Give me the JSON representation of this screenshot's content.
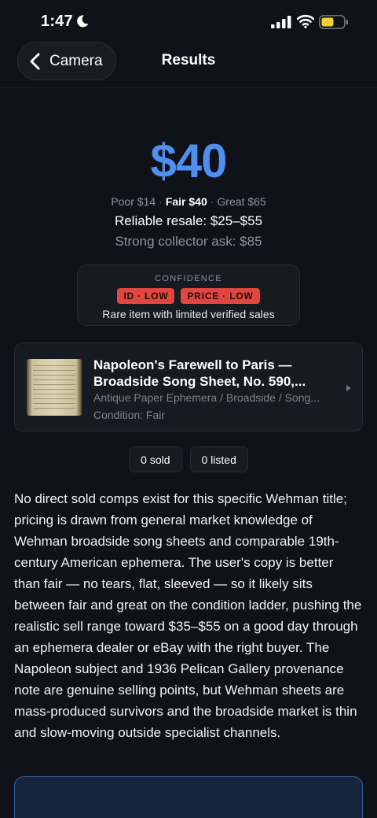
{
  "status_bar": {
    "time": "1:47"
  },
  "nav": {
    "back_label": "Camera",
    "title": "Results"
  },
  "valuation": {
    "price": "$40",
    "poor": "Poor $14",
    "fair": "Fair $40",
    "great": "Great $65",
    "reliable_resale": "Reliable resale: $25–$55",
    "collector_ask": "Strong collector ask: $85"
  },
  "confidence": {
    "label": "CONFIDENCE",
    "badges": [
      "ID · LOW",
      "PRICE · LOW"
    ],
    "note": "Rare item with limited verified sales",
    "badge_color": "#e2463f"
  },
  "item": {
    "title": "Napoleon's Farewell to Paris — Broadside Song Sheet, No. 590,...",
    "category": "Antique Paper Ephemera / Broadside / Song...",
    "condition": "Condition: Fair"
  },
  "counts": {
    "sold": "0 sold",
    "listed": "0 listed"
  },
  "summary": "No direct sold comps exist for this specific Wehman title; pricing is drawn from general market knowledge of Wehman broadside song sheets and comparable 19th-century American ephemera. The user's copy is better than fair — no tears, flat, sleeved — so it likely sits between fair and great on the condition ladder, pushing the realistic sell range toward $35–$55 on a good day through an ephemera dealer or eBay with the right buyer. The Napoleon subject and 1936 Pelican Gallery provenance note are genuine selling points, but Wehman sheets are mass-produced survivors and the broadside market is thin and slow-moving outside specialist channels.",
  "colors": {
    "accent": "#4f8ff0",
    "background": "#0f1218",
    "battery": "#f5d033"
  }
}
